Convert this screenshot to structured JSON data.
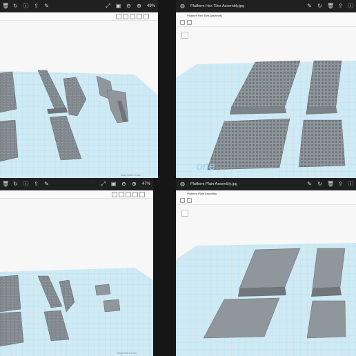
{
  "panes": {
    "top_left": {
      "zoom": "49%",
      "status": "Snap Grid 1.0 mm",
      "icons": [
        "trash-icon",
        "rotate-icon",
        "info-icon",
        "share-icon",
        "fit-icon",
        "slideshow-icon",
        "zoom-out-icon",
        "zoom-in-icon"
      ]
    },
    "top_right": {
      "title": "Platform Hex Tiles Assembly.jpg",
      "doc_title": "Platform Hex Tiles Assembly",
      "watermark": "one"
    },
    "bottom_left": {
      "zoom": "47%",
      "status": "Snap Grid 1.0 mm"
    },
    "bottom_right": {
      "title": "Platform Plain Assembly.jpg",
      "doc_title": "Platform Plain Assembly"
    }
  },
  "colors": {
    "grid": "#cfeaf4",
    "grid_line": "#9fd2e8",
    "model": "#8f969c",
    "model_dark": "#5f666c",
    "titlebar": "#202020"
  }
}
